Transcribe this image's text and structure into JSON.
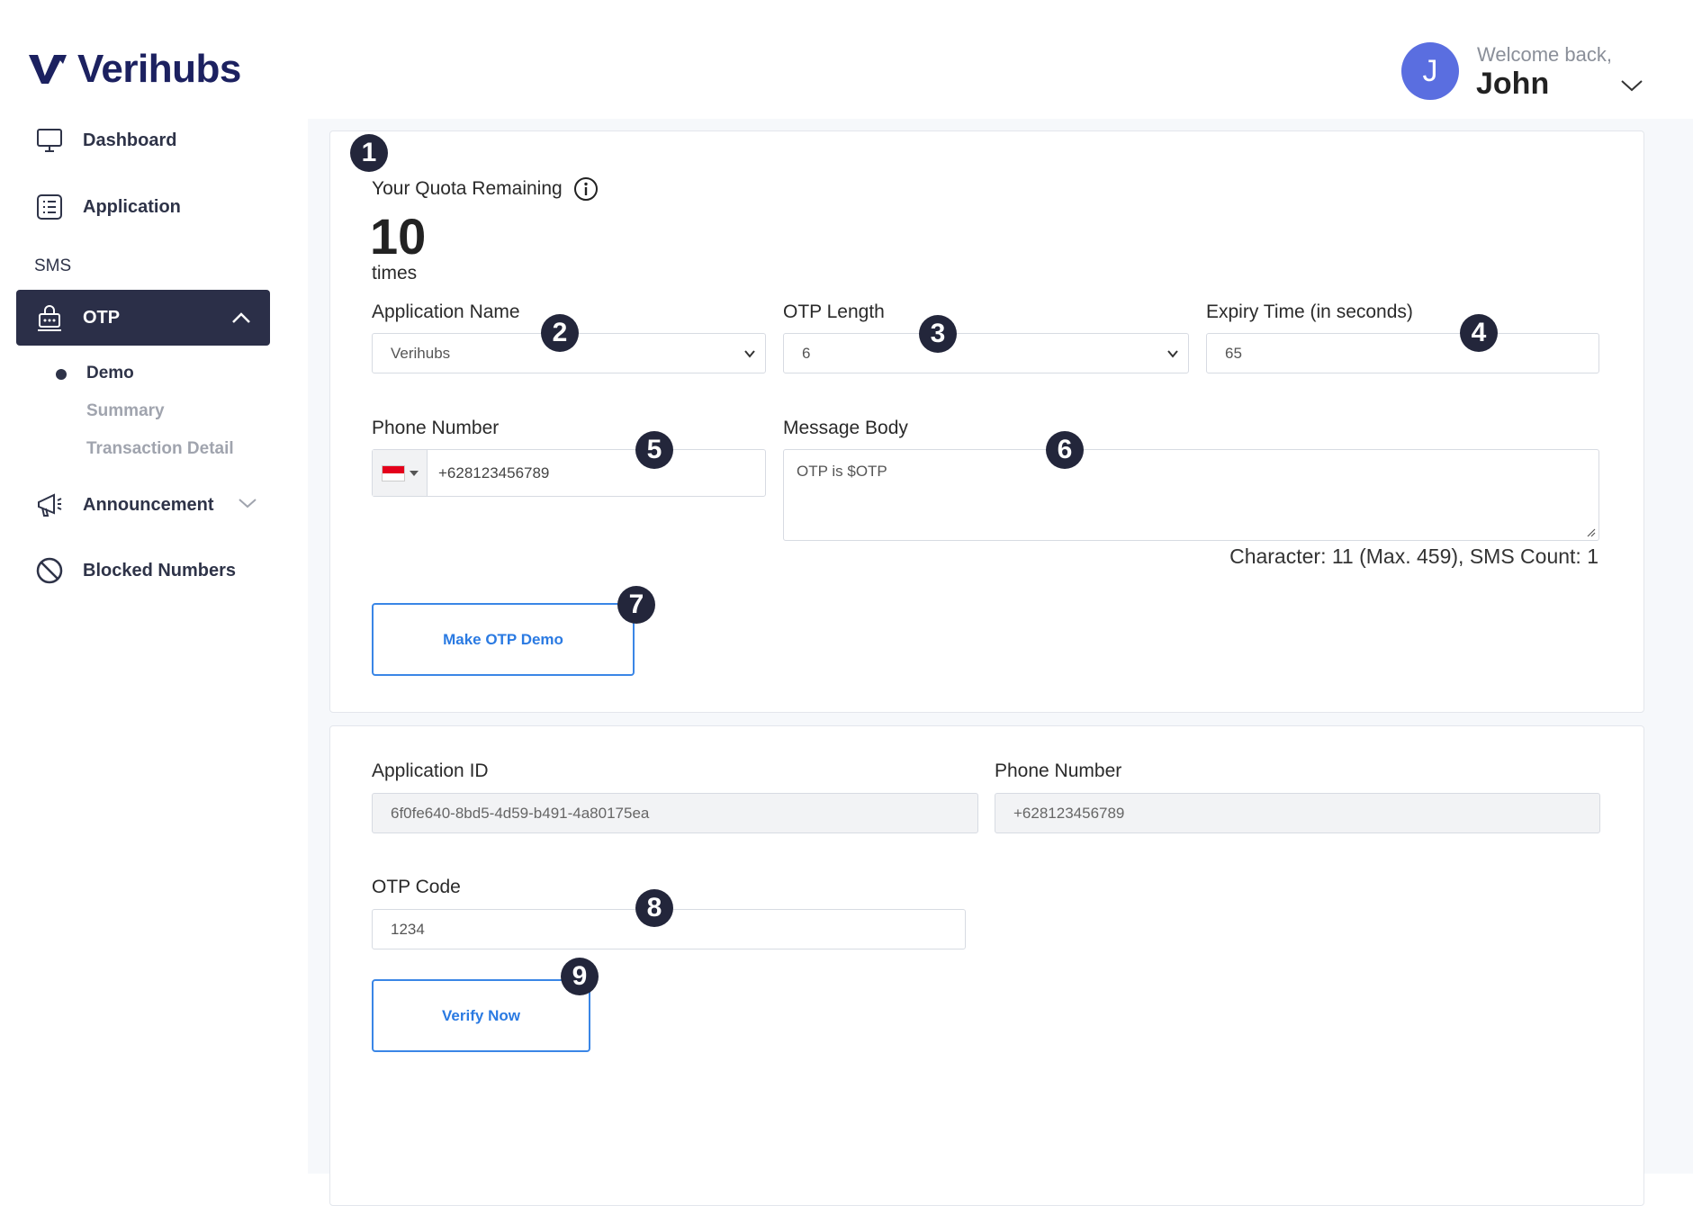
{
  "brand": {
    "name": "Verihubs"
  },
  "sidebar": {
    "items": [
      {
        "label": "Dashboard",
        "icon": "monitor-icon"
      },
      {
        "label": "Application",
        "icon": "list-icon"
      }
    ],
    "section_label": "SMS",
    "active_item": {
      "label": "OTP",
      "icon": "otp-lock-icon"
    },
    "sub_items": [
      {
        "label": "Demo",
        "active": true
      },
      {
        "label": "Summary",
        "active": false
      },
      {
        "label": "Transaction Detail",
        "active": false
      }
    ],
    "more_items": [
      {
        "label": "Announcement",
        "icon": "megaphone-icon"
      },
      {
        "label": "Blocked Numbers",
        "icon": "blocked-icon"
      }
    ]
  },
  "header": {
    "avatar_initial": "J",
    "welcome": "Welcome back,",
    "username": "John"
  },
  "quota": {
    "title": "Your Quota Remaining",
    "value": "10",
    "unit": "times"
  },
  "form": {
    "app_name": {
      "label": "Application Name",
      "value": "Verihubs"
    },
    "otp_length": {
      "label": "OTP Length",
      "value": "6"
    },
    "expiry": {
      "label": "Expiry Time (in seconds)",
      "value": "65"
    },
    "phone": {
      "label": "Phone Number",
      "value": "+628123456789"
    },
    "message": {
      "label": "Message Body",
      "value": "OTP is $OTP"
    },
    "char_count": "Character: 11 (Max. 459), SMS Count: 1",
    "submit_label": "Make OTP Demo"
  },
  "verify": {
    "app_id": {
      "label": "Application ID",
      "value": "6f0fe640-8bd5-4d59-b491-4a80175ea"
    },
    "phone": {
      "label": "Phone Number",
      "value": "+628123456789"
    },
    "otp_code": {
      "label": "OTP Code",
      "value": "1234"
    },
    "submit_label": "Verify Now"
  },
  "badges": [
    "1",
    "2",
    "3",
    "4",
    "5",
    "6",
    "7",
    "8",
    "9"
  ],
  "colors": {
    "primary": "#2b2f48",
    "accent": "#3a86e6",
    "avatar": "#5a6ee0",
    "brand": "#1c2160"
  }
}
